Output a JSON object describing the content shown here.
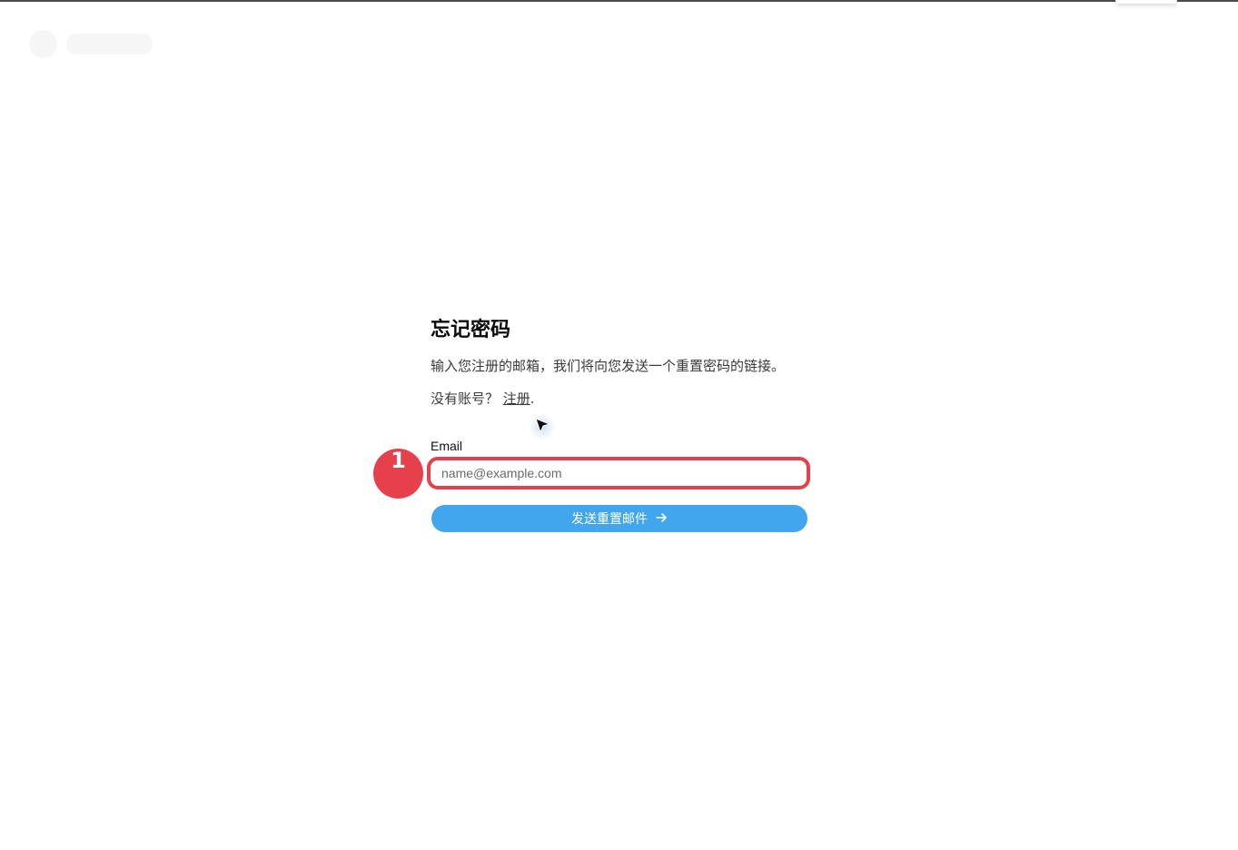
{
  "form": {
    "title": "忘记密码",
    "subtitle": "输入您注册的邮箱，我们将向您发送一个重置密码的链接。",
    "no_account_text": "没有账号？ ",
    "signup_link": "注册",
    "signup_suffix": ".",
    "email_label": "Email",
    "email_placeholder": "name@example.com",
    "email_value": "",
    "submit_label": "发送重置邮件"
  },
  "annotation": {
    "step_number": "1"
  },
  "colors": {
    "accent": "#42a6ee",
    "highlight": "#e6404c"
  },
  "icons": {
    "submit": "arrow-right-icon",
    "pointer": "mouse-cursor-icon"
  }
}
